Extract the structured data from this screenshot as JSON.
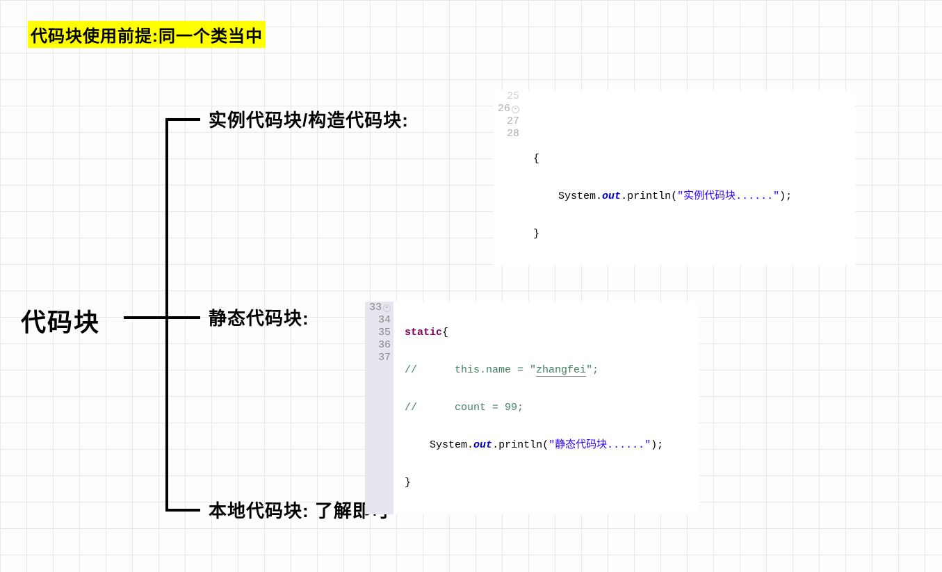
{
  "title": "代码块使用前提:同一个类当中",
  "root": "代码块",
  "branches": {
    "b1": "实例代码块/构造代码块:",
    "b2": "静态代码块:",
    "b3": "本地代码块: 了解即可"
  },
  "code1": {
    "ln25": "25",
    "ln26": "26",
    "ln27": "27",
    "ln28": "28",
    "l1": "{",
    "l2a": "    System.",
    "l2b": "out",
    "l2c": ".println(",
    "l2d": "\"实例代码块......\"",
    "l2e": ");",
    "l3": "}"
  },
  "code2": {
    "ln33": "33",
    "ln34": "34",
    "ln35": "35",
    "ln36": "36",
    "ln37": "37",
    "l1a": "static",
    "l1b": "{",
    "l2": "//      this.name = \"zhangfei\";",
    "l2_pre": "//      this.name = \"",
    "l2_zf": "zhangfei",
    "l2_post": "\";",
    "l3": "//      count = 99;",
    "l4a": "    System.",
    "l4b": "out",
    "l4c": ".println(",
    "l4d": "\"静态代码块......\"",
    "l4e": ");",
    "l5": "}"
  }
}
